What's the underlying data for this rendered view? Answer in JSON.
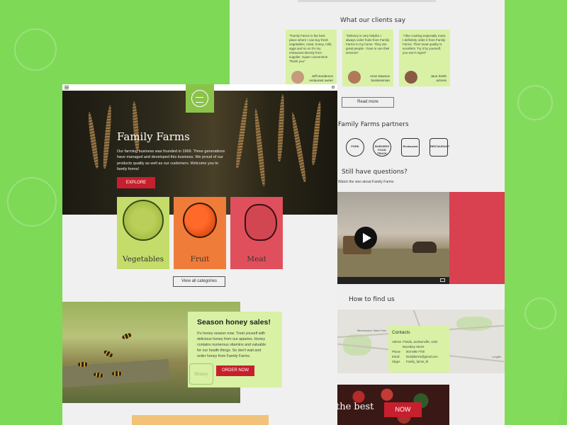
{
  "colors": {
    "background": "#7ed957",
    "accent_red": "#c71f2d",
    "card_green": "#d8f1a5",
    "logo_green": "#8bc34a"
  },
  "right_page": {
    "testimonials_heading": "What our clients say",
    "testimonials": [
      {
        "text": "\"Family Farms is the best place where I can buy fresh vegetables, meat, honey, milk, eggs and so on for my restaurant directly from supplier. Super convenient! Thank you\"",
        "name": "Jeff Henderson",
        "role": "restaurant owner"
      },
      {
        "text": "\"Delivery is very helpful. I always order fruits from Family Farms to my home. They are great people. I love to use their services\"",
        "name": "Anne Dawson",
        "role": "businessman"
      },
      {
        "text": "\"I like cooking especially meat. I definitely order it from Family Farms. Their meat quality is excellent. Try it by yourself, you won't regret\"",
        "name": "Jane Smith",
        "role": "actress"
      }
    ],
    "read_more_label": "Read more",
    "partners_heading": "Family Farms partners",
    "partners": [
      "FORK",
      "BURGERS FOOD TRUCK",
      "Restaurant",
      "RESTAURANT"
    ],
    "questions_heading": "Still have questions?",
    "video_caption": "Watch the vieo about Family Farms",
    "find_us_heading": "How to find us",
    "map_labels": [
      "Minnesota's State Park",
      "Longfle"
    ],
    "contacts": {
      "title": "Contacts",
      "rows": [
        {
          "key": "Adress",
          "value": "Florida, Jacksonville, 1334 Boundary Street"
        },
        {
          "key": "Phone",
          "value": "904-595-7700"
        },
        {
          "key": "Email",
          "value": "familyfarms@gmail.com"
        },
        {
          "key": "Skype",
          "value": "Family_farms_fd"
        }
      ]
    },
    "banner_text": "the best",
    "now_label": "NOW"
  },
  "left_page": {
    "hero_title": "Family Farms",
    "hero_text": "Our farming business was founded in 1969. Three generations have managed and developed this business. We proud of our products quality as well as our customers. Welcome you to family forms!",
    "explore_label": "EXPLORE",
    "categories": [
      {
        "label": "Vegetables",
        "color": "#c4dc6a"
      },
      {
        "label": "Fruit",
        "color": "#f07c3a"
      },
      {
        "label": "Meat",
        "color": "#e0505c"
      }
    ],
    "view_all_label": "View all categories",
    "honey": {
      "title": "Season honey sales!",
      "text": "It's honey season now. Treat youself with delicious honey from our apiaries. Honey contains numerous vitamins and valuable for our health things. So don't wait and order honey from Family Farms.",
      "order_label": "ORDER NOW",
      "jar_text": "Honey"
    }
  }
}
